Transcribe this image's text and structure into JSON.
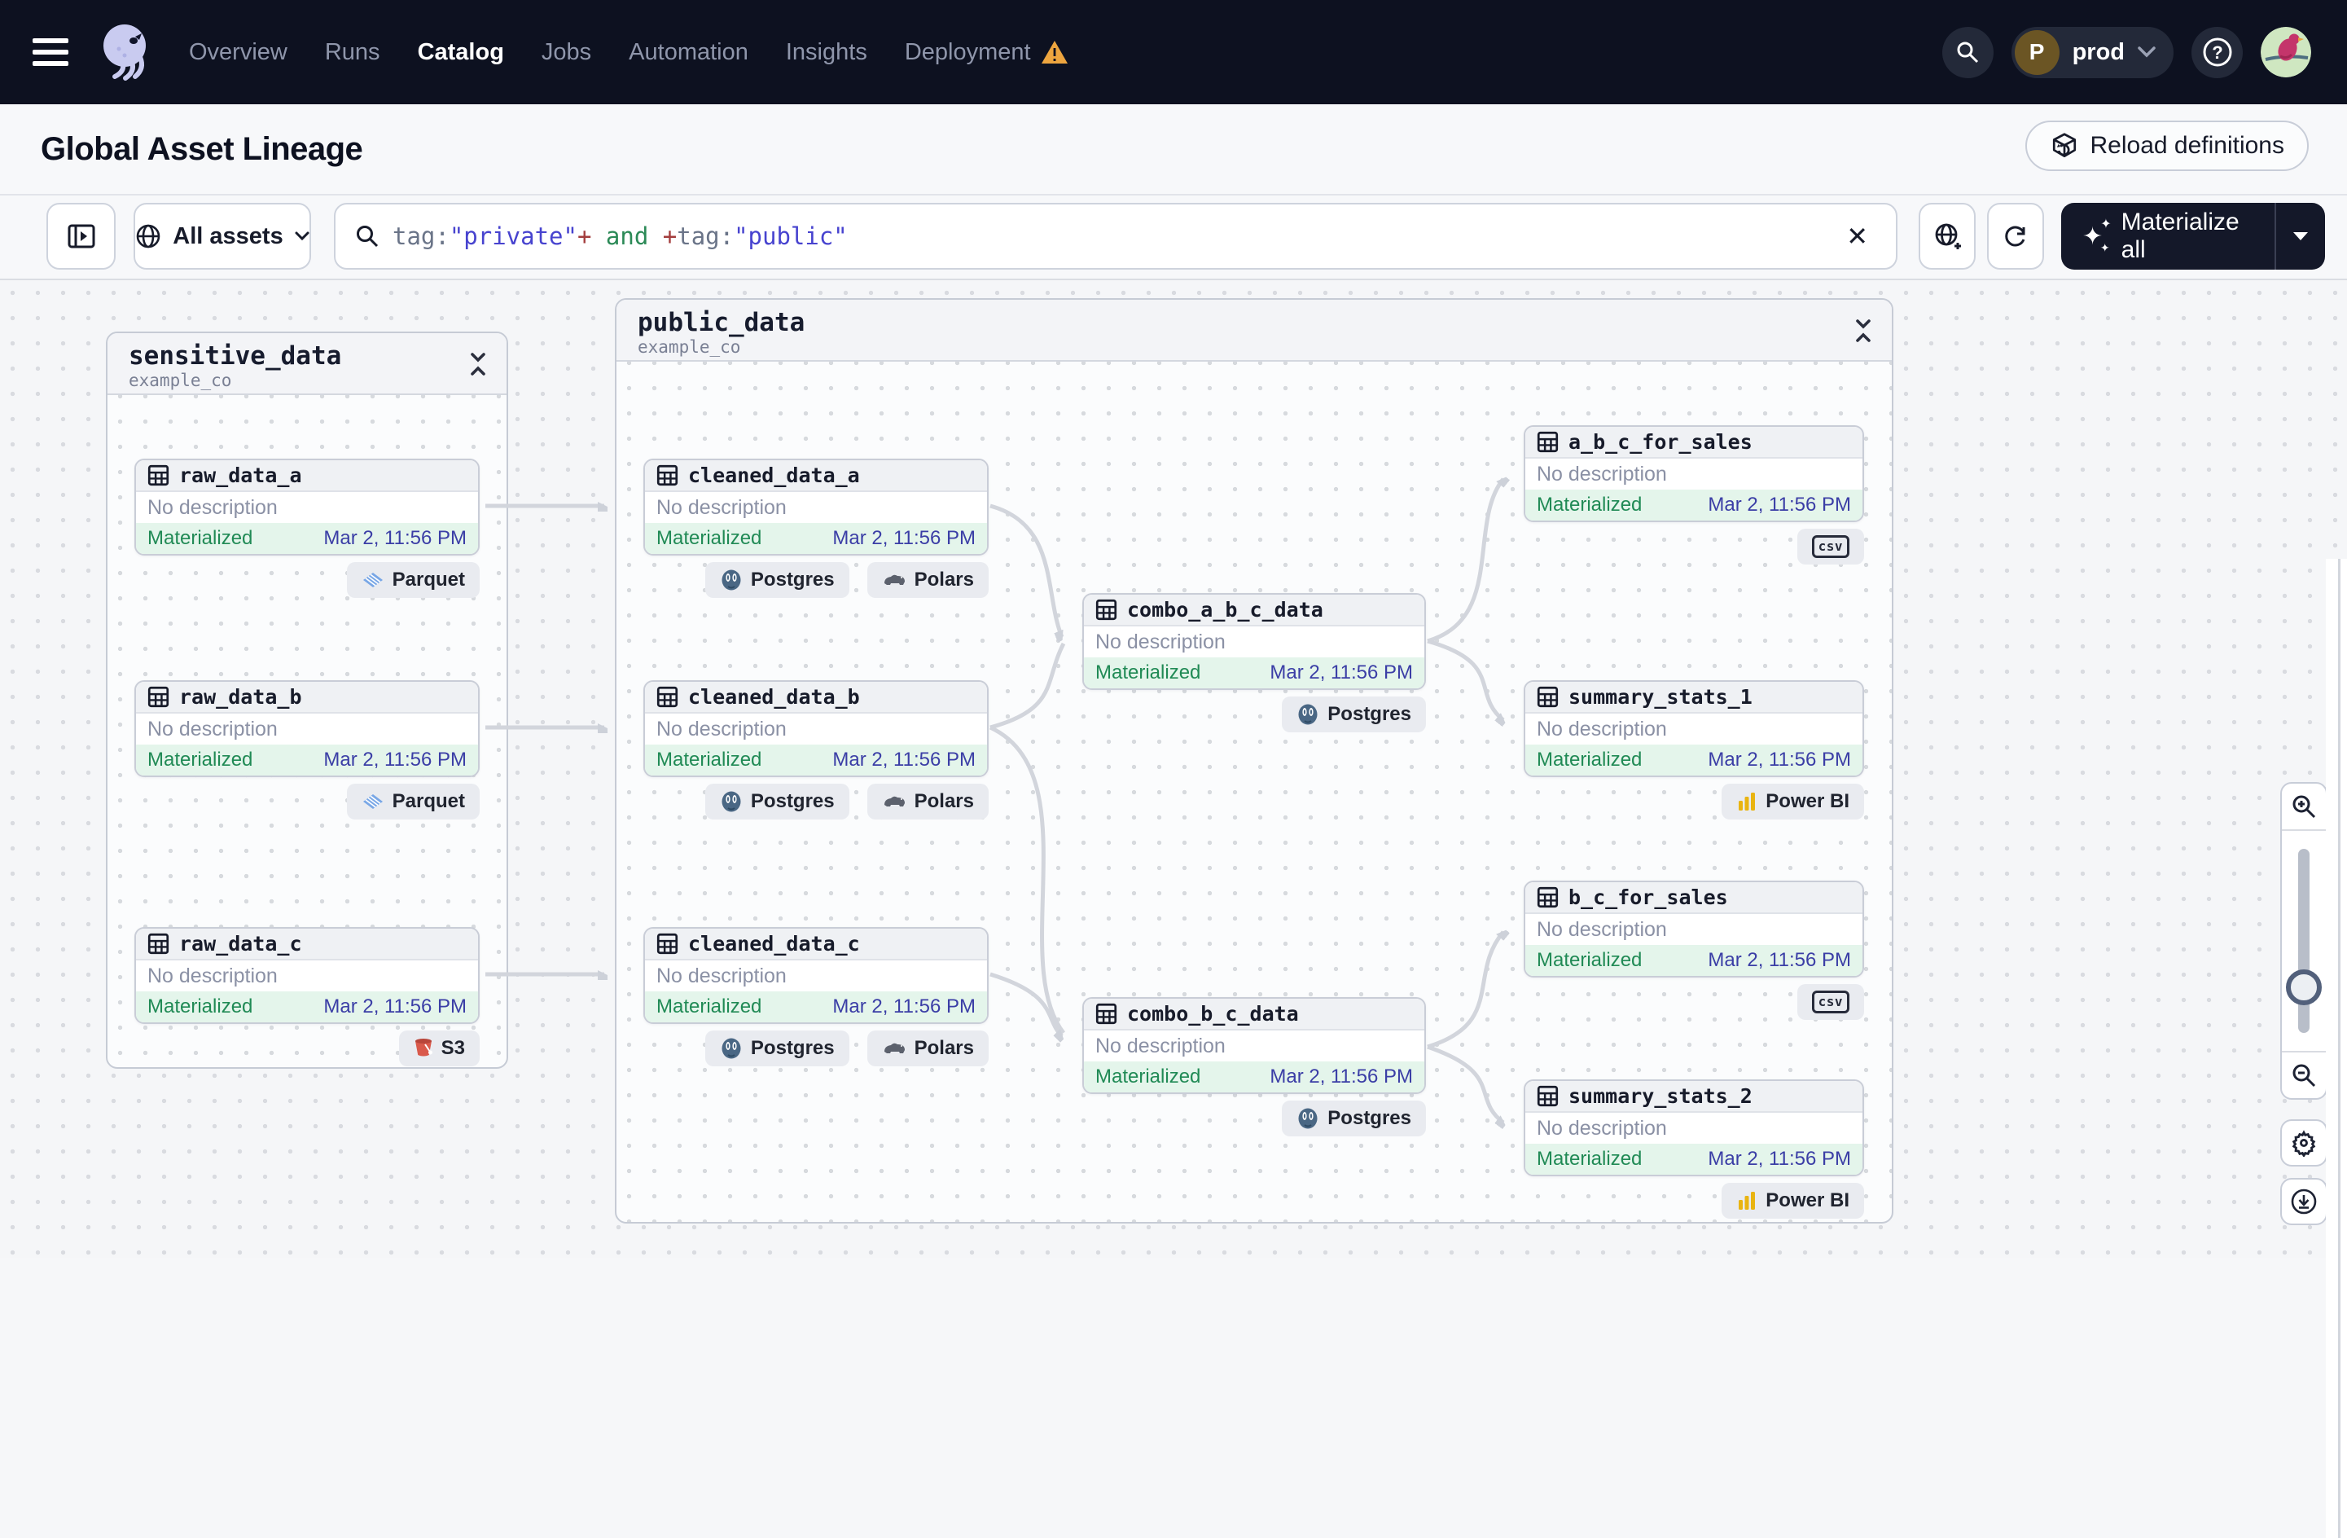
{
  "nav": {
    "items": [
      {
        "label": "Overview",
        "active": false
      },
      {
        "label": "Runs",
        "active": false
      },
      {
        "label": "Catalog",
        "active": true
      },
      {
        "label": "Jobs",
        "active": false
      },
      {
        "label": "Automation",
        "active": false
      },
      {
        "label": "Insights",
        "active": false
      },
      {
        "label": "Deployment",
        "active": false
      }
    ],
    "env": {
      "initial": "P",
      "name": "prod"
    }
  },
  "title_bar": {
    "title": "Global Asset Lineage",
    "reload_button": "Reload definitions"
  },
  "toolbar": {
    "scope_label": "All assets",
    "search": {
      "parts": [
        {
          "text": "tag:",
          "type": "key"
        },
        {
          "text": "\"private\"",
          "type": "value"
        },
        {
          "text": "+",
          "type": "op"
        },
        {
          "text": " and ",
          "type": "bool"
        },
        {
          "text": "+",
          "type": "op"
        },
        {
          "text": "tag:",
          "type": "key"
        },
        {
          "text": "\"public\"",
          "type": "value"
        }
      ]
    },
    "materialize_label": "Materialize all"
  },
  "graph": {
    "groups": [
      {
        "name": "sensitive_data",
        "subtitle": "example_co"
      },
      {
        "name": "public_data",
        "subtitle": "example_co"
      }
    ],
    "nodes": [
      {
        "name": "raw_data_a",
        "description": "No description",
        "status": "Materialized",
        "time": "Mar 2, 11:56 PM",
        "tags": [
          {
            "label": "Parquet",
            "icon": "parquet"
          }
        ]
      },
      {
        "name": "raw_data_b",
        "description": "No description",
        "status": "Materialized",
        "time": "Mar 2, 11:56 PM",
        "tags": [
          {
            "label": "Parquet",
            "icon": "parquet"
          }
        ]
      },
      {
        "name": "raw_data_c",
        "description": "No description",
        "status": "Materialized",
        "time": "Mar 2, 11:56 PM",
        "tags": [
          {
            "label": "S3",
            "icon": "s3"
          }
        ]
      },
      {
        "name": "cleaned_data_a",
        "description": "No description",
        "status": "Materialized",
        "time": "Mar 2, 11:56 PM",
        "tags": [
          {
            "label": "Postgres",
            "icon": "postgres"
          },
          {
            "label": "Polars",
            "icon": "polars"
          }
        ]
      },
      {
        "name": "cleaned_data_b",
        "description": "No description",
        "status": "Materialized",
        "time": "Mar 2, 11:56 PM",
        "tags": [
          {
            "label": "Postgres",
            "icon": "postgres"
          },
          {
            "label": "Polars",
            "icon": "polars"
          }
        ]
      },
      {
        "name": "cleaned_data_c",
        "description": "No description",
        "status": "Materialized",
        "time": "Mar 2, 11:56 PM",
        "tags": [
          {
            "label": "Postgres",
            "icon": "postgres"
          },
          {
            "label": "Polars",
            "icon": "polars"
          }
        ]
      },
      {
        "name": "combo_a_b_c_data",
        "description": "No description",
        "status": "Materialized",
        "time": "Mar 2, 11:56 PM",
        "tags": [
          {
            "label": "Postgres",
            "icon": "postgres"
          }
        ]
      },
      {
        "name": "combo_b_c_data",
        "description": "No description",
        "status": "Materialized",
        "time": "Mar 2, 11:56 PM",
        "tags": [
          {
            "label": "Postgres",
            "icon": "postgres"
          }
        ]
      },
      {
        "name": "a_b_c_for_sales",
        "description": "No description",
        "status": "Materialized",
        "time": "Mar 2, 11:56 PM",
        "tags": [
          {
            "label": "csv",
            "icon": "csv"
          }
        ]
      },
      {
        "name": "summary_stats_1",
        "description": "No description",
        "status": "Materialized",
        "time": "Mar 2, 11:56 PM",
        "tags": [
          {
            "label": "Power BI",
            "icon": "powerbi"
          }
        ]
      },
      {
        "name": "b_c_for_sales",
        "description": "No description",
        "status": "Materialized",
        "time": "Mar 2, 11:56 PM",
        "tags": [
          {
            "label": "csv",
            "icon": "csv"
          }
        ]
      },
      {
        "name": "summary_stats_2",
        "description": "No description",
        "status": "Materialized",
        "time": "Mar 2, 11:56 PM",
        "tags": [
          {
            "label": "Power BI",
            "icon": "powerbi"
          }
        ]
      }
    ]
  },
  "colors": {
    "navbar_bg": "#0d1120",
    "accent_indigo": "#4743cf",
    "status_green": "#208a55",
    "status_green_bg": "#e4f5eb",
    "timestamp_blue": "#3b3ea6",
    "warning_orange": "#eda53f",
    "edge_gray": "#d2d5dc"
  }
}
